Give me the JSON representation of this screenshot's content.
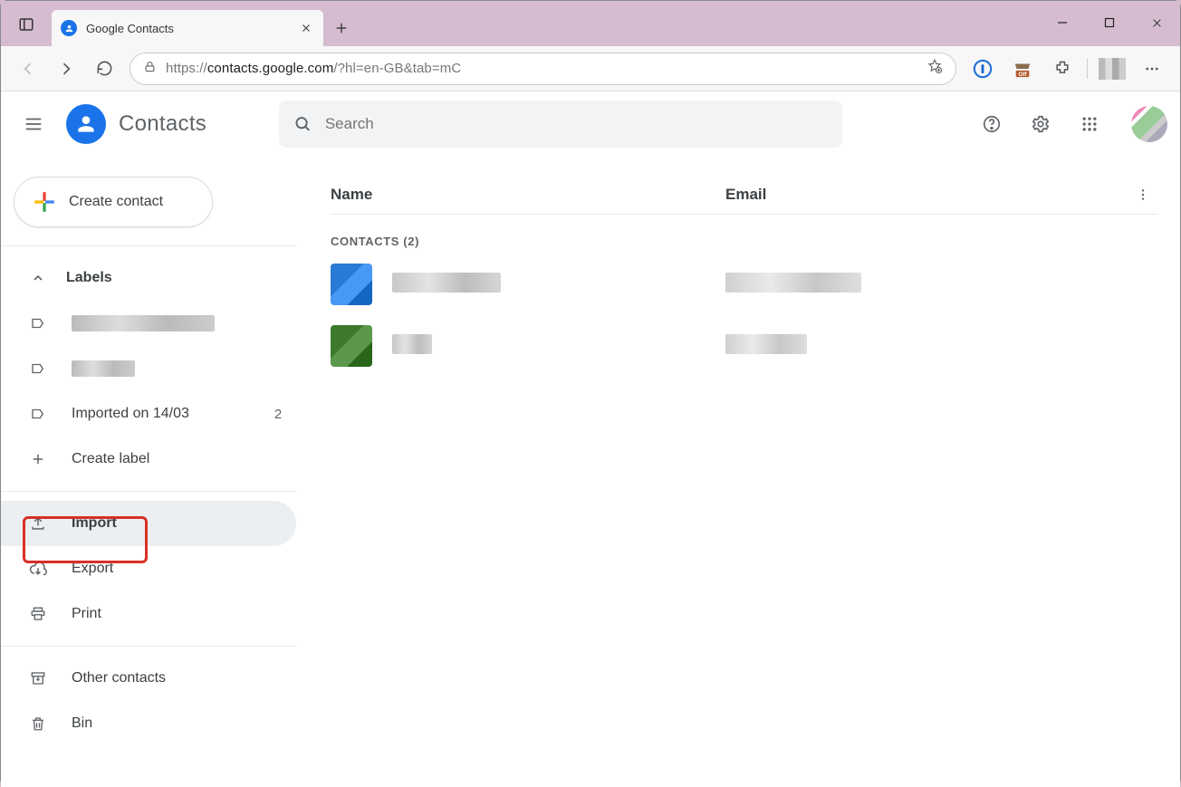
{
  "browser": {
    "tab_title": "Google Contacts",
    "url_display_host": "https://",
    "url_display_main": "contacts.google.com",
    "url_display_path": "/?hl=en-GB&tab=mC"
  },
  "app": {
    "title": "Contacts",
    "search_placeholder": "Search"
  },
  "sidebar": {
    "create_label": "Create contact",
    "labels_header": "Labels",
    "label_items": [
      {
        "label": "",
        "redacted": true,
        "redact_w": 158,
        "count": ""
      },
      {
        "label": "",
        "redacted": true,
        "redact_w": 70,
        "count": ""
      },
      {
        "label": "Imported on 14/03",
        "redacted": false,
        "count": "2"
      }
    ],
    "create_label_label": "Create label",
    "actions": {
      "import": "Import",
      "export": "Export",
      "print": "Print"
    },
    "other_contacts": "Other contacts",
    "bin": "Bin"
  },
  "main": {
    "col_name": "Name",
    "col_email": "Email",
    "section_prefix": "CONTACTS",
    "contacts_count": 2,
    "rows": [
      {
        "avatar_color": "#2a7bd6",
        "name_w": 120,
        "email_w": 150
      },
      {
        "avatar_color": "#3d7a2d",
        "name_w": 44,
        "email_w": 90
      }
    ]
  }
}
